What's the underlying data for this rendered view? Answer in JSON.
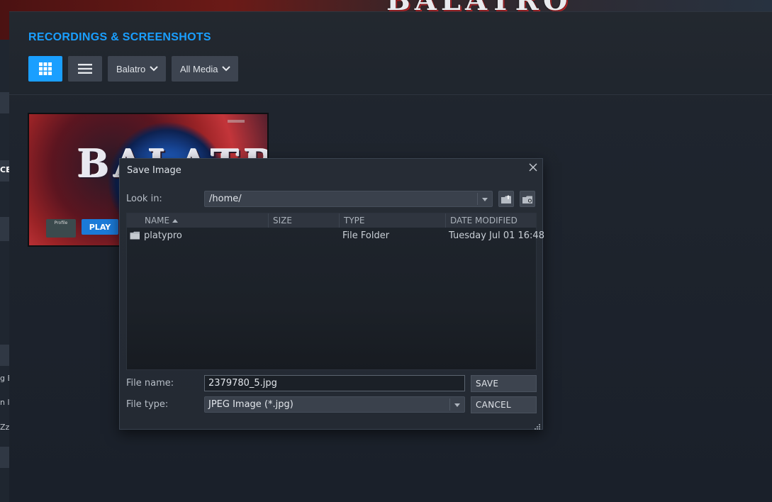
{
  "background": {
    "hero_logo_text": "BALATRO"
  },
  "sidebar": {
    "fragments": [
      "CE",
      "g E",
      "n l",
      "Zz'"
    ]
  },
  "panel": {
    "title": "RECORDINGS & SCREENSHOTS",
    "view_grid_icon": "grid-icon",
    "view_list_icon": "list-icon",
    "game_filter": "Balatro",
    "media_filter": "All Media"
  },
  "thumbnail": {
    "logo_text": "BALATRO",
    "play_label": "PLAY",
    "profile_label": "Profile"
  },
  "dialog": {
    "title": "Save Image",
    "look_in_label": "Look in:",
    "look_in_value": "/home/",
    "columns": [
      "NAME",
      "SIZE",
      "TYPE",
      "DATE MODIFIED"
    ],
    "rows": [
      {
        "name": "platypro",
        "size": "",
        "type": "File Folder",
        "date_modified": "Tuesday Jul 01 16:48"
      }
    ],
    "file_name_label": "File name:",
    "file_name_value": "2379780_5.jpg",
    "file_type_label": "File type:",
    "file_type_value": "JPEG Image (*.jpg)",
    "save_label": "SAVE",
    "cancel_label": "CANCEL"
  },
  "colors": {
    "accent": "#1a9fff",
    "panel_bg": "#1f252e",
    "dialog_bg": "#262c35"
  }
}
